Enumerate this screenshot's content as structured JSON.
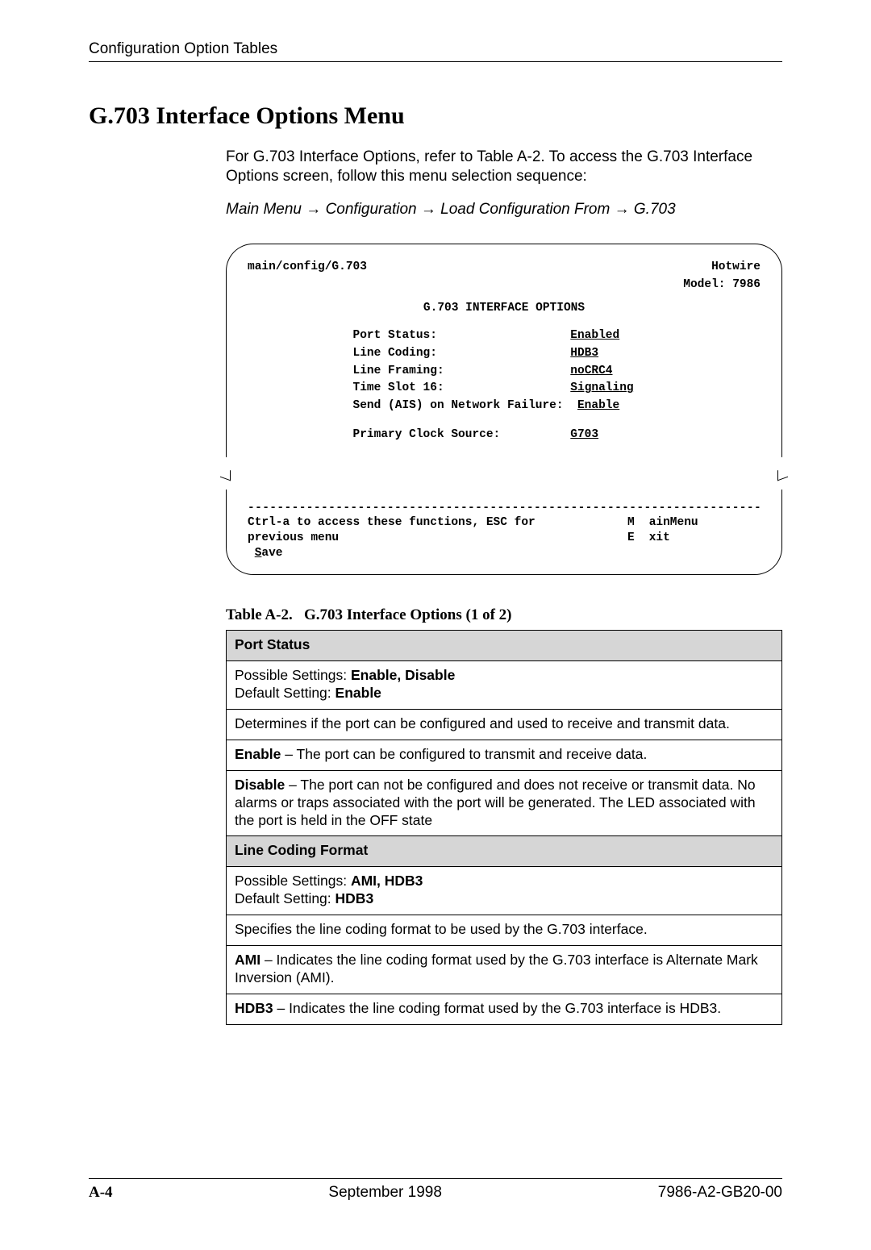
{
  "header": "Configuration Option Tables",
  "heading": "G.703 Interface Options Menu",
  "intro": "For G.703 Interface Options, refer to Table A-2. To access the G.703 Interface Options screen, follow this menu selection sequence:",
  "menu_path": {
    "p0": "Main Menu",
    "p1": "Configuration",
    "p2": "Load Configuration From",
    "p3": "G.703",
    "arrow": "→"
  },
  "terminal": {
    "path": "main/config/G.703",
    "brand": "Hotwire",
    "model_label": "Model: 7986",
    "title": "G.703 INTERFACE OPTIONS",
    "rows": [
      {
        "label": "Port Status:",
        "value": "Enabled"
      },
      {
        "label": "Line Coding:",
        "value": "HDB3"
      },
      {
        "label": "Line Framing:",
        "value": "noCRC4"
      },
      {
        "label": "Time Slot 16:",
        "value": "Signaling"
      },
      {
        "label": "Send (AIS) on Network Failure:",
        "value": "Enable"
      }
    ],
    "row2": {
      "label": "Primary Clock Source:",
      "value": "G703"
    },
    "help": "Ctrl-a to access these functions, ESC for previous menu",
    "mainmenu_char": "M",
    "mainmenu_rest": "ainMenu",
    "exit_char": "E",
    "exit_rest": "xit",
    "save_char": "S",
    "save_rest": "ave"
  },
  "table": {
    "caption_prefix": "Table A-2.",
    "caption": "G.703 Interface Options (1 of 2)",
    "port_status": {
      "head": "Port Status",
      "poss_label": "Possible Settings: ",
      "poss_val": "Enable, Disable",
      "def_label": "Default Setting: ",
      "def_val": "Enable",
      "desc": "Determines if the port can be configured and used to receive and transmit data.",
      "enable_lead": "Enable",
      "enable_text": " – The port can be configured to transmit and receive data.",
      "disable_lead": "Disable",
      "disable_text": " – The port can not be configured and does not receive or transmit data. No alarms or traps associated with the port will be generated. The LED associated with the port is held in the OFF state"
    },
    "line_coding": {
      "head": "Line Coding Format",
      "poss_label": "Possible Settings: ",
      "poss_val": "AMI, HDB3",
      "def_label": "Default Setting: ",
      "def_val": "HDB3",
      "desc": "Specifies the line coding format to be used by the G.703 interface.",
      "ami_lead": "AMI",
      "ami_text": " – Indicates the line coding format used by the G.703 interface is Alternate Mark Inversion (AMI).",
      "hdb3_lead": "HDB3",
      "hdb3_text": " – Indicates the line coding format used by the G.703 interface is HDB3."
    }
  },
  "footer": {
    "page": "A-4",
    "date": "September 1998",
    "docnum": "7986-A2-GB20-00"
  }
}
